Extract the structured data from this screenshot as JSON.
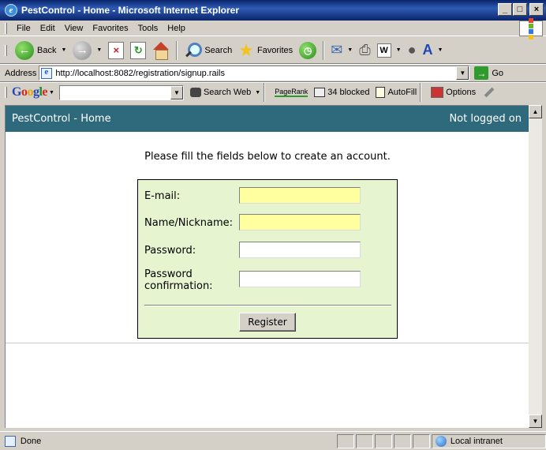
{
  "window": {
    "title": "PestControl - Home - Microsoft Internet Explorer",
    "controls": [
      "_",
      "□",
      "×"
    ]
  },
  "menu": [
    "File",
    "Edit",
    "View",
    "Favorites",
    "Tools",
    "Help"
  ],
  "toolbar": {
    "back_label": "Back",
    "search_label": "Search",
    "favorites_label": "Favorites"
  },
  "address": {
    "label": "Address",
    "url": "http://localhost:8082/registration/signup.rails",
    "go_label": "Go"
  },
  "google_toolbar": {
    "logo": [
      "G",
      "o",
      "o",
      "g",
      "l",
      "e"
    ],
    "search_web_label": "Search Web",
    "pagerank_label": "PageRank",
    "blocked_label": "34 blocked",
    "autofill_label": "AutoFill",
    "options_label": "Options"
  },
  "app": {
    "header_title": "PestControl - Home",
    "login_status": "Not logged on",
    "intro_text": "Please fill the fields below to create an account.",
    "form": {
      "email_label": "E-mail:",
      "name_label": "Name/Nickname:",
      "password_label": "Password:",
      "password_confirmation_label": "Password confirmation:",
      "email_value": "",
      "name_value": "",
      "password_value": "",
      "password_confirmation_value": "",
      "register_label": "Register"
    }
  },
  "status": {
    "text": "Done",
    "zone": "Local intranet"
  },
  "colors": {
    "app_header_bg": "#2f6a7c",
    "form_bg": "#e6f5cf",
    "required_field_bg": "#ffffa0",
    "title_bar": "#0a246a"
  }
}
